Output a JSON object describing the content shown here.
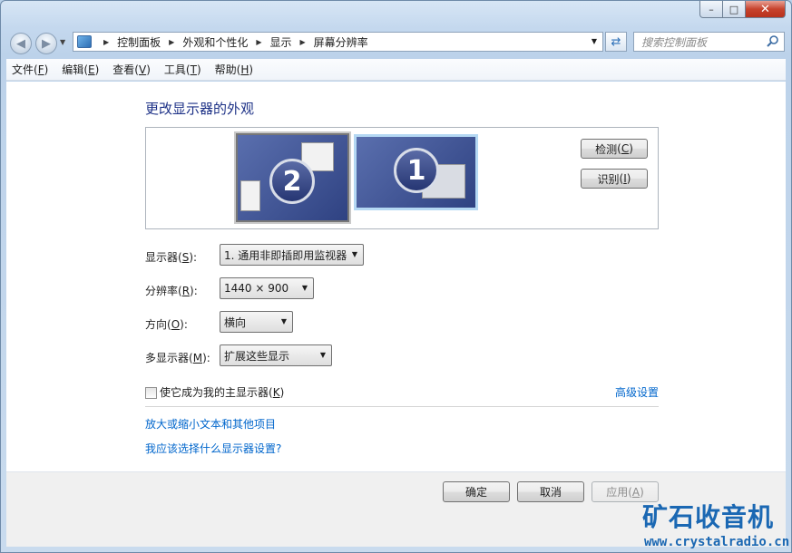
{
  "window": {
    "caption": {
      "minimize": "–",
      "maximize": "□",
      "close": "✕"
    }
  },
  "nav": {
    "back_icon": "◀",
    "forward_icon": "▶",
    "refresh_icon": "⇄",
    "breadcrumbs": [
      "控制面板",
      "外观和个性化",
      "显示",
      "屏幕分辨率"
    ],
    "search_placeholder": "搜索控制面板"
  },
  "menu": [
    {
      "label": "文件",
      "key": "F"
    },
    {
      "label": "编辑",
      "key": "E"
    },
    {
      "label": "查看",
      "key": "V"
    },
    {
      "label": "工具",
      "key": "T"
    },
    {
      "label": "帮助",
      "key": "H"
    }
  ],
  "main": {
    "title": "更改显示器的外观",
    "monitors": {
      "primary_number": "1",
      "secondary_number": "2"
    },
    "detect_button": {
      "label": "检测",
      "key": "C"
    },
    "identify_button": {
      "label": "识别",
      "key": "I"
    },
    "display": {
      "label": "显示器",
      "key": "S",
      "value": "1. 通用非即插即用监视器"
    },
    "resolution": {
      "label": "分辨率",
      "key": "R",
      "value": "1440 × 900"
    },
    "orientation": {
      "label": "方向",
      "key": "O",
      "value": "横向"
    },
    "multiple_displays": {
      "label": "多显示器",
      "key": "M",
      "value": "扩展这些显示"
    },
    "main_display_checkbox": {
      "label": "使它成为我的主显示器",
      "key": "K",
      "checked": false
    },
    "advanced_link": "高级设置",
    "link_text_size": "放大或缩小文本和其他项目",
    "link_help": "我应该选择什么显示器设置?"
  },
  "footer": {
    "ok": "确定",
    "cancel": "取消",
    "apply": {
      "label": "应用",
      "key": "A"
    }
  },
  "watermark": {
    "name": "矿石收音机",
    "url": "www.crystalradio.cn"
  },
  "colors": {
    "accent": "#1e3287",
    "link": "#0066cc",
    "watermark": "#1b68b3"
  }
}
